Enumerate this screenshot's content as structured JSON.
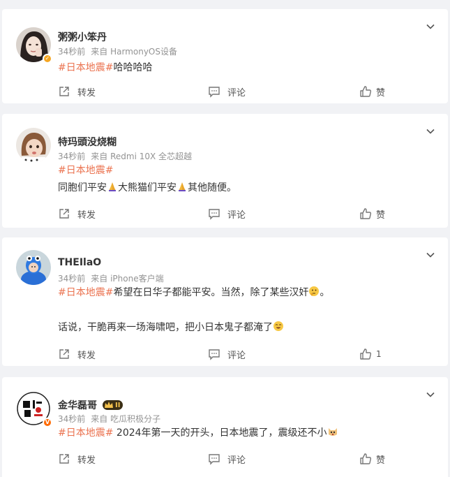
{
  "actions": {
    "share": "转发",
    "comment": "评论",
    "like": "赞"
  },
  "posts": [
    {
      "name": "粥粥小笨丹",
      "time": "34秒前",
      "source": "来自 HarmonyOS设备",
      "tag": "#日本地震#",
      "line1": "哈哈哈哈",
      "like_label": "赞"
    },
    {
      "name": "特玛頭没烧糊",
      "time": "34秒前",
      "source": "来自 Redmi 10X 全芯超越",
      "tag": "#日本地震#",
      "line2_a": "同胞们平安",
      "line2_b": "大熊猫们平安",
      "line2_c": "其他随便。",
      "like_label": "赞"
    },
    {
      "name": "THEIlaO",
      "time": "34秒前",
      "source": "来自 iPhone客户端",
      "tag": "#日本地震#",
      "line1": "希望在日华子都能平安。当然，除了某些汉奸",
      "line1_end": "。",
      "line3": "话说，干脆再来一场海啸吧，把小日本鬼子都淹了",
      "like_count": "1"
    },
    {
      "name": "金华磊哥",
      "time": "34秒前",
      "source": "来自 吃瓜积极分子",
      "tag": "#日本地震#",
      "line1": " 2024年第一天的开头，日本地震了，震级还不小",
      "level": "II",
      "like_label": "赞"
    }
  ],
  "colors": {
    "tag": "#eb7350",
    "meta": "#939393",
    "text": "#333333",
    "background": "#f1f2f5"
  }
}
